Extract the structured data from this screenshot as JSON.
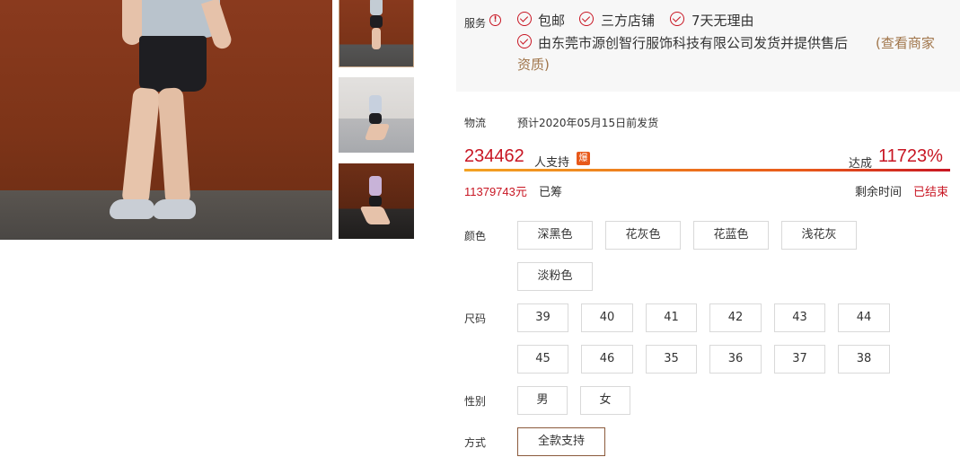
{
  "service": {
    "label": "服务",
    "items": [
      "包邮",
      "三方店铺",
      "7天无理由"
    ],
    "seller_text": "由东莞市源创智行服饰科技有限公司发货并提供售后",
    "seller_link_line1": "(查看商家",
    "seller_link_line2": "资质)"
  },
  "logistics": {
    "label": "物流",
    "text": "预计2020年05月15日前发货"
  },
  "funding": {
    "supporters": "234462",
    "supporters_unit": "人支持",
    "hot_badge": "爆",
    "achieved_label": "达成",
    "achieved_percent": "11723%",
    "progress_fraction": 1.0,
    "raised_amount": "11379743元",
    "raised_label": "已筹",
    "remaining_label": "剩余时间",
    "remaining_value": "已结束"
  },
  "options": {
    "color": {
      "label": "颜色",
      "values": [
        "深黑色",
        "花灰色",
        "花蓝色",
        "浅花灰",
        "淡粉色"
      ]
    },
    "size": {
      "label": "尺码",
      "values": [
        "39",
        "40",
        "41",
        "42",
        "43",
        "44",
        "45",
        "46",
        "35",
        "36",
        "37",
        "38"
      ]
    },
    "gender": {
      "label": "性别",
      "values": [
        "男",
        "女"
      ]
    },
    "method": {
      "label": "方式",
      "values": [
        "全款支持"
      ],
      "selected": "全款支持"
    }
  },
  "colors": {
    "accent_red": "#c81623",
    "link_brown": "#a0754a",
    "selected_border": "#8b5a3c",
    "service_bg": "#f7f7f7"
  }
}
